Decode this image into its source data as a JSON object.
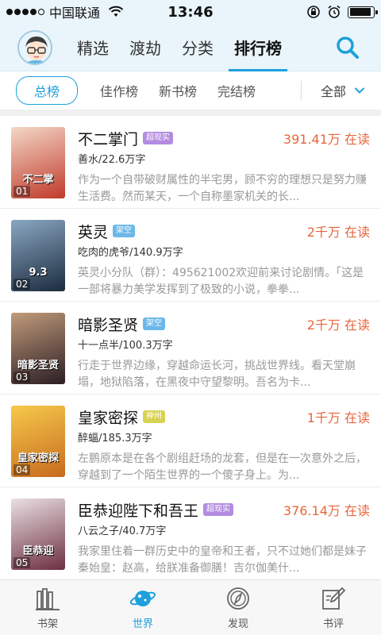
{
  "status": {
    "carrier": "中国联通",
    "time": "13:46",
    "battery_level": 0.9
  },
  "topnav": {
    "tabs": [
      {
        "label": "精选",
        "active": false
      },
      {
        "label": "渡劫",
        "active": false
      },
      {
        "label": "分类",
        "active": false
      },
      {
        "label": "排行榜",
        "active": true
      }
    ],
    "search_icon": "search-icon",
    "avatar_icon": "avatar-icon"
  },
  "subnav": {
    "tabs": [
      {
        "label": "总榜",
        "active": true
      },
      {
        "label": "佳作榜",
        "active": false
      },
      {
        "label": "新书榜",
        "active": false
      },
      {
        "label": "完结榜",
        "active": false
      }
    ],
    "filter_label": "全部",
    "filter_icon": "chevron-down-icon"
  },
  "books": [
    {
      "rank": "01",
      "title": "不二掌门",
      "tag": "超现实",
      "tag_color": "#b38be0",
      "reads": "391.41万 在读",
      "author": "善水/22.6万字",
      "desc": "作为一个自带破财属性的半宅男，顾不穷的理想只是努力赚生活费。然而某天，一个自称墨家机关的长...",
      "cover_text": "不二掌",
      "cover_colors": [
        "#f4d7c6",
        "#c03a2b"
      ]
    },
    {
      "rank": "02",
      "title": "英灵",
      "tag": "架空",
      "tag_color": "#6bb8e8",
      "reads": "2千万 在读",
      "author": "吃肉的虎爷/140.9万字",
      "desc": "英灵小分队（群）：495621002欢迎前来讨论剧情。「这是一部将暴力美学发挥到了极致的小说，拳拳...",
      "cover_text": "9.3",
      "cover_colors": [
        "#8aa7c2",
        "#1b2c3e"
      ]
    },
    {
      "rank": "03",
      "title": "暗影圣贤",
      "tag": "架空",
      "tag_color": "#6bb8e8",
      "reads": "2千万 在读",
      "author": "十一点半/100.3万字",
      "desc": "行走于世界边缘，穿越命运长河，挑战世界线。看天堂崩塌，地狱陷落，在黑夜中守望黎明。吾名为卡...",
      "cover_text": "暗影圣贤",
      "cover_colors": [
        "#c19b7a",
        "#2b1d24"
      ]
    },
    {
      "rank": "04",
      "title": "皇家密探",
      "tag": "神州",
      "tag_color": "#d8d252",
      "reads": "1千万 在读",
      "author": "醉蝠/185.3万字",
      "desc": "左鹏原本是在各个剧组赶场的龙套，但是在一次意外之后，穿越到了一个陌生世界的一个傻子身上。为...",
      "cover_text": "皇家密探",
      "cover_colors": [
        "#f6c94b",
        "#c76b1e"
      ]
    },
    {
      "rank": "05",
      "title": "臣恭迎陛下和吾王",
      "tag": "超现实",
      "tag_color": "#b38be0",
      "reads": "376.14万 在读",
      "author": "八云之子/40.7万字",
      "desc": "我家里住着一群历史中的皇帝和王者，只不过她们都是妹子秦始皇：赵高，给朕准备御膳！吉尔伽美什...",
      "cover_text": "臣恭迎",
      "cover_colors": [
        "#e9e0e4",
        "#6d2f3f"
      ]
    }
  ],
  "tabbar": {
    "items": [
      {
        "label": "书架",
        "icon": "bookshelf-icon",
        "active": false
      },
      {
        "label": "世界",
        "icon": "planet-icon",
        "active": true
      },
      {
        "label": "发现",
        "icon": "compass-icon",
        "active": false
      },
      {
        "label": "书评",
        "icon": "pen-icon",
        "active": false
      }
    ]
  },
  "colors": {
    "accent": "#1ea0dc",
    "reads": "#e8663d"
  }
}
